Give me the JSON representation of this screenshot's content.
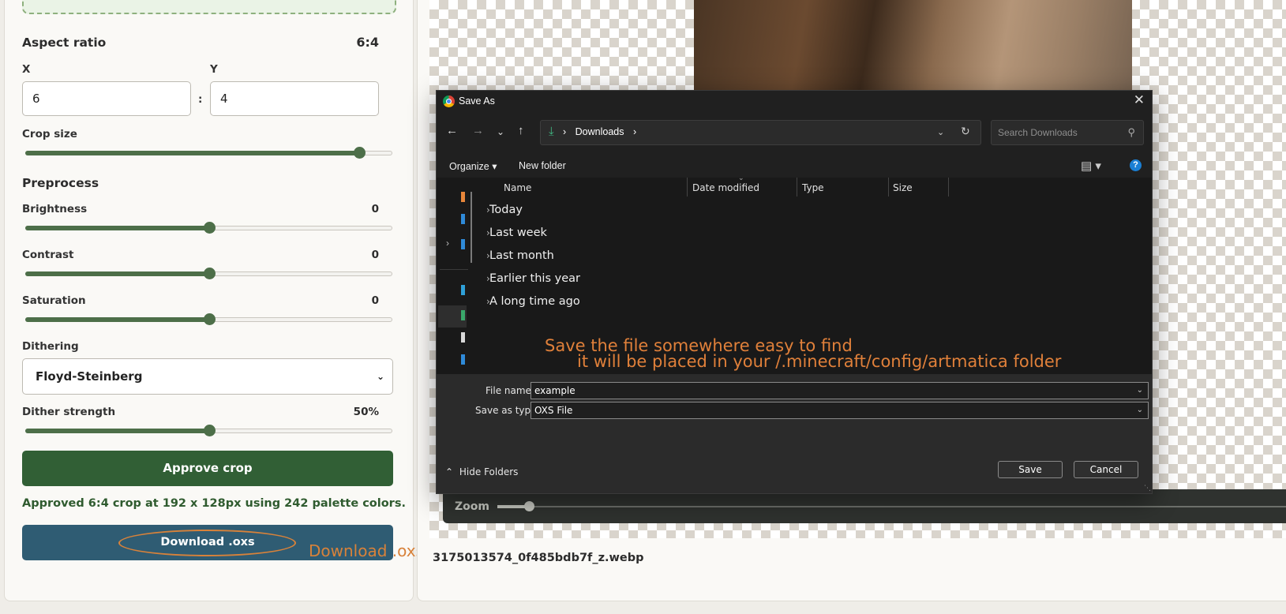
{
  "left_panel": {
    "aspect_ratio": {
      "heading": "Aspect ratio",
      "value": "6:4",
      "x_label": "X",
      "y_label": "Y",
      "x_value": "6",
      "y_value": "4",
      "separator": ":"
    },
    "crop_size": {
      "label": "Crop size",
      "level": 0.91
    },
    "preprocess": {
      "heading": "Preprocess",
      "brightness": {
        "label": "Brightness",
        "value": "0",
        "level": 0.5
      },
      "contrast": {
        "label": "Contrast",
        "value": "0",
        "level": 0.5
      },
      "saturation": {
        "label": "Saturation",
        "value": "0",
        "level": 0.5
      }
    },
    "dithering": {
      "label": "Dithering",
      "selected": "Floyd-Steinberg"
    },
    "dither_strength": {
      "label": "Dither strength",
      "value": "50%",
      "level": 0.5
    },
    "approve_button": "Approve crop",
    "approved_message": "Approved 6:4 crop at 192 x 128px using 242 palette colors.",
    "download_button": "Download .oxs",
    "annotation": "Download .oxs"
  },
  "right_panel": {
    "zoom_label": "Zoom",
    "zoom_level": 0.04,
    "filename": "3175013574_0f485bdb7f_z.webp"
  },
  "dialog": {
    "title": "Save As",
    "address": {
      "separator": "›",
      "folder": "Downloads"
    },
    "search_placeholder": "Search Downloads",
    "toolbar": {
      "organize": "Organize ▾",
      "new_folder": "New folder"
    },
    "columns": [
      "Name",
      "Date modified",
      "Type",
      "Size"
    ],
    "groups": [
      "Today",
      "Last week",
      "Last month",
      "Earlier this year",
      "A long time ago"
    ],
    "annotation": {
      "line1": "Save the file somewhere easy to find",
      "line2": "it will be placed in your /.minecraft/config/artmatica folder"
    },
    "file_name_label": "File name:",
    "file_name_value": "example",
    "save_type_label": "Save as type:",
    "save_type_value": "OXS File",
    "hide_folders": "Hide Folders",
    "save_button": "Save",
    "cancel_button": "Cancel"
  },
  "colors": {
    "accent_green": "#315f35",
    "slider_green": "#4d6f49",
    "download_blue": "#2f5c73",
    "annotation_orange": "#d8823a",
    "dialog_bg": "#202020"
  }
}
